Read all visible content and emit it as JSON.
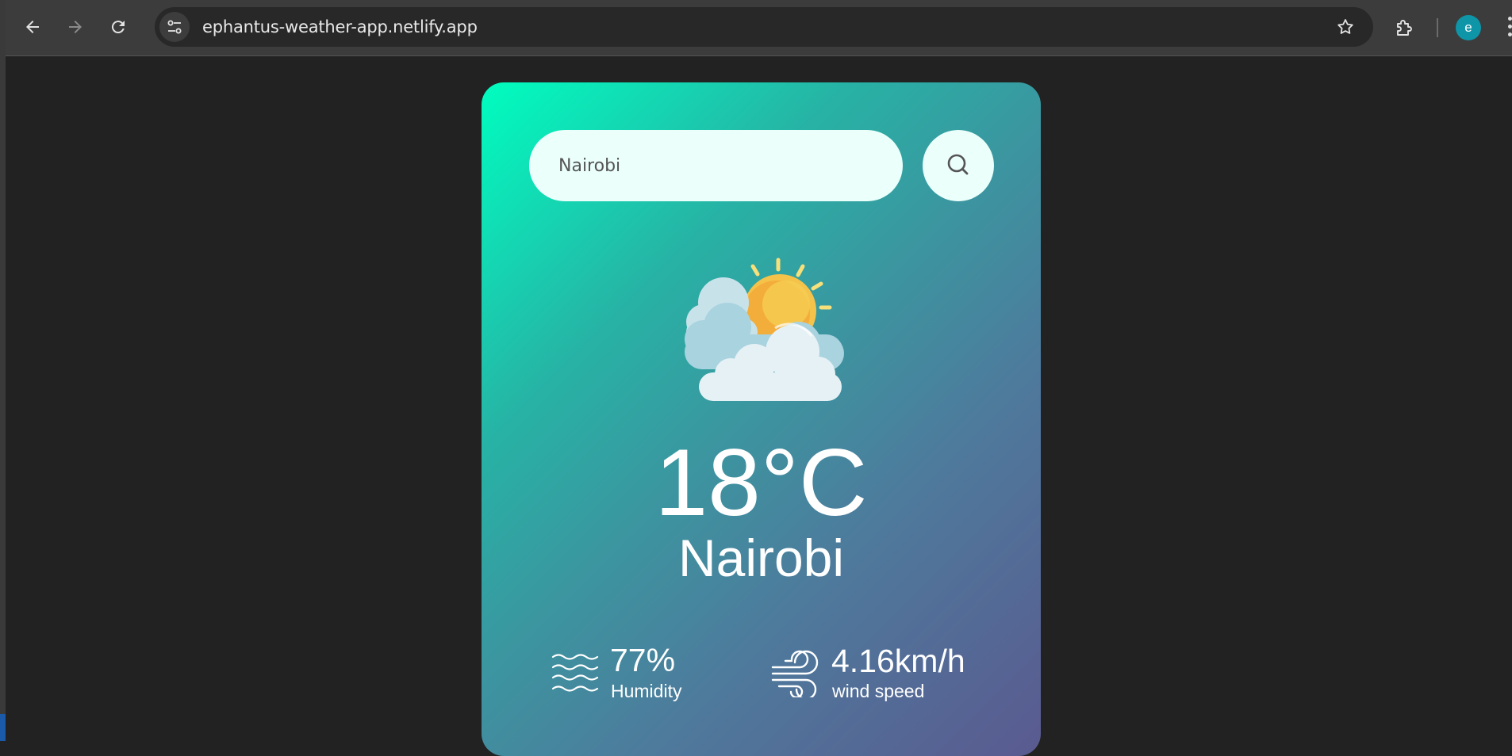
{
  "browser": {
    "url": "ephantus-weather-app.netlify.app",
    "profile_initial": "e",
    "icons": {
      "back": "arrow-left-icon",
      "forward": "arrow-right-icon",
      "reload": "reload-icon",
      "site_info": "tune-icon",
      "bookmark": "star-icon",
      "extensions": "puzzle-icon",
      "menu": "more-vert-icon"
    }
  },
  "weather": {
    "search": {
      "value": "Nairobi",
      "placeholder": ""
    },
    "condition_icon": "partly-cloudy-icon",
    "temperature": "18°C",
    "city": "Nairobi",
    "humidity": {
      "value": "77%",
      "label": "Humidity",
      "icon": "humidity-waves-icon"
    },
    "wind": {
      "value": "4.16km/h",
      "label": "wind speed",
      "icon": "wind-icon"
    }
  },
  "colors": {
    "page_bg": "#222222",
    "toolbar_bg": "#3c3c3c",
    "omnibox_bg": "#282828",
    "card_gradient_start": "#00fec0",
    "card_gradient_end": "#5a5a90",
    "input_bg": "#ebfffb",
    "avatar": "#0e95a8"
  }
}
